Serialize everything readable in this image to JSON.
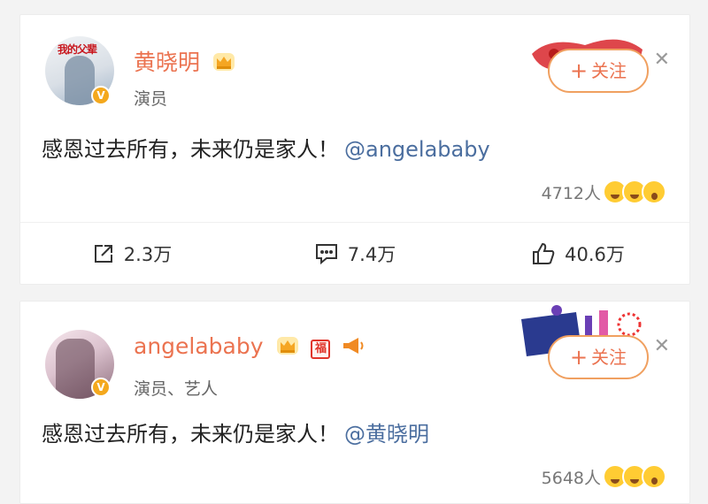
{
  "posts": [
    {
      "author": "黄晓明",
      "role": "演员",
      "avatar_banner": "我的父辈",
      "follow_label": "关注",
      "text": "感恩过去所有，未来仍是家人！",
      "mention": "@angelababy",
      "reaction_count": "4712人",
      "actions": {
        "repost": "2.3万",
        "comment": "7.4万",
        "like": "40.6万"
      }
    },
    {
      "author": "angelababy",
      "role": "演员、艺人",
      "badge_fu": "福",
      "follow_label": "关注",
      "text": "感恩过去所有，未来仍是家人！",
      "mention": "@黄晓明",
      "reaction_count": "5648人"
    }
  ],
  "icons": [
    "crown-icon",
    "fu-badge-icon",
    "horn-icon",
    "plus-icon",
    "close-icon",
    "repost-icon",
    "comment-icon",
    "like-icon",
    "verified-icon",
    "reaction-emoji-icon"
  ],
  "colors": {
    "name": "#eb7350",
    "mention": "#4b6e9f",
    "follow_border": "#f0a060",
    "verified": "#f4a81d"
  }
}
